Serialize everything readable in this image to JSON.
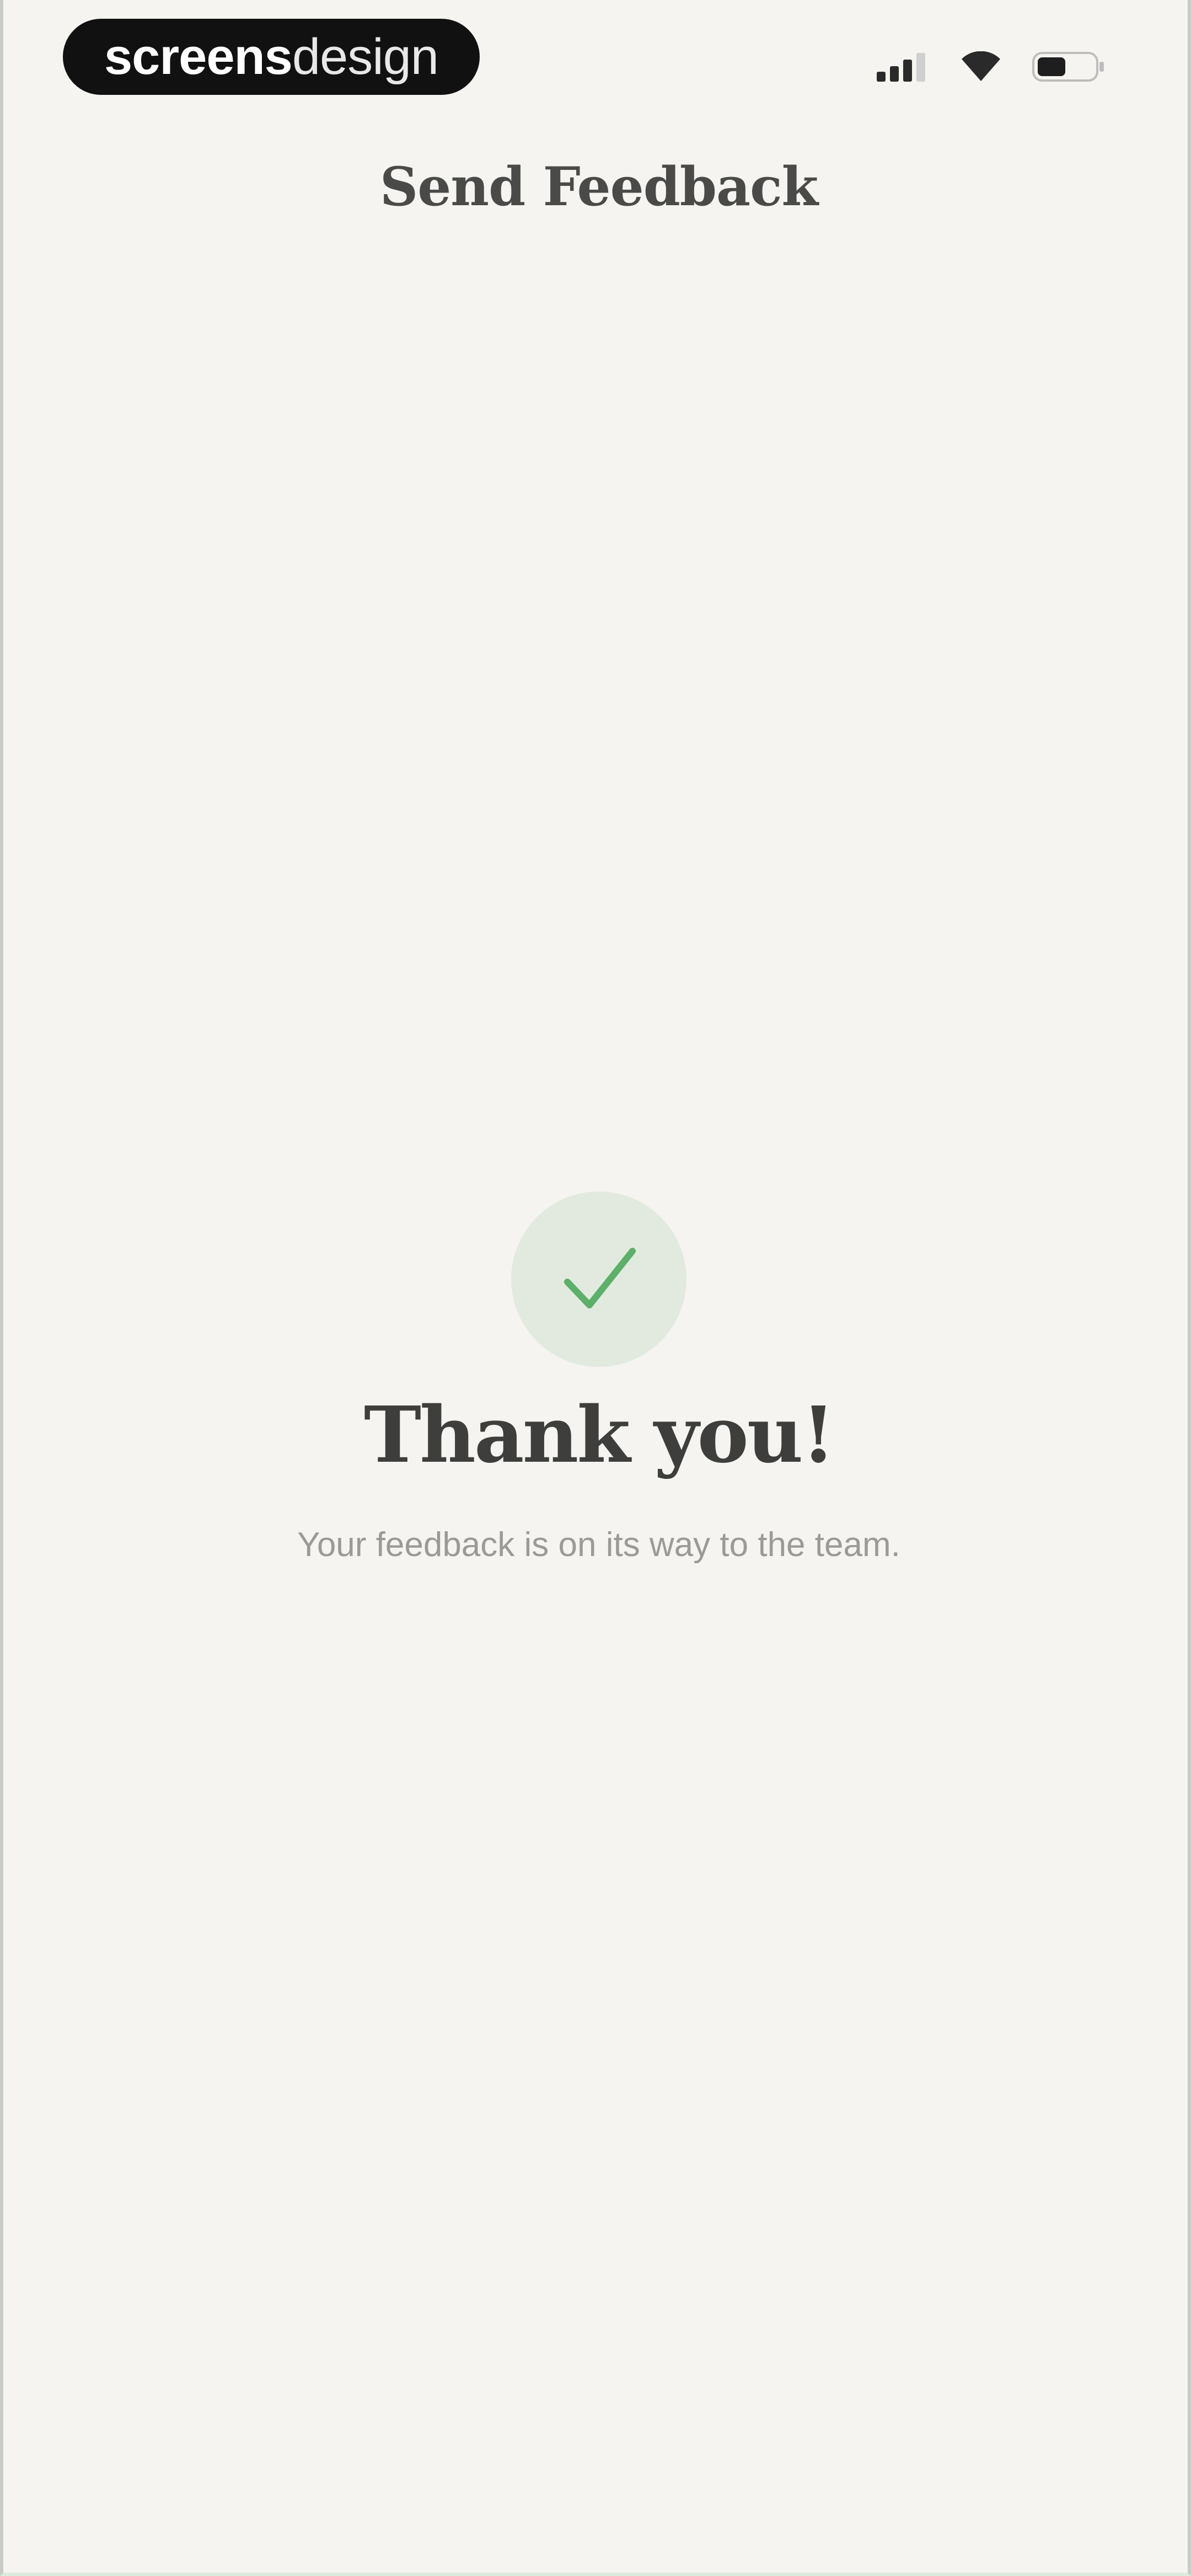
{
  "status_bar": {
    "brand_bold": "screens",
    "brand_light": "design",
    "icons": [
      "signal-icon",
      "wifi-icon",
      "battery-icon"
    ]
  },
  "header": {
    "title": "Send Feedback"
  },
  "success": {
    "icon": "checkmark-icon",
    "headline": "Thank you!",
    "message": "Your feedback is on its way to the team."
  },
  "colors": {
    "background": "#F5F4F0",
    "success_green": "#5CB069",
    "success_badge_bg": "#E2EAE0",
    "title_text": "#4A4A48",
    "muted_text": "#9A9A96"
  }
}
